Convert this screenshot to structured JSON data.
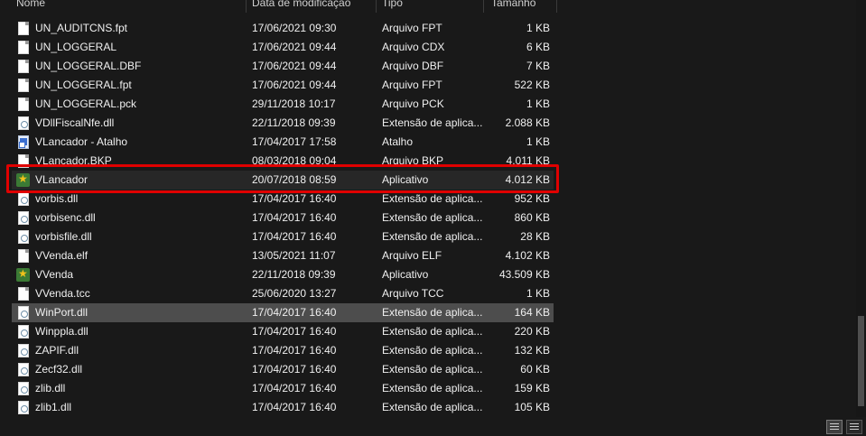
{
  "columns": {
    "name": "Nome",
    "date": "Data de modificação",
    "type": "Tipo",
    "size": "Tamanho"
  },
  "files": [
    {
      "name": "UN_AUDITCNS.fpt",
      "date": "17/06/2021 09:30",
      "type": "Arquivo FPT",
      "size": "1 KB",
      "icon": "file-icon"
    },
    {
      "name": "UN_LOGGERAL",
      "date": "17/06/2021 09:44",
      "type": "Arquivo CDX",
      "size": "6 KB",
      "icon": "file-icon"
    },
    {
      "name": "UN_LOGGERAL.DBF",
      "date": "17/06/2021 09:44",
      "type": "Arquivo DBF",
      "size": "7 KB",
      "icon": "file-icon"
    },
    {
      "name": "UN_LOGGERAL.fpt",
      "date": "17/06/2021 09:44",
      "type": "Arquivo FPT",
      "size": "522 KB",
      "icon": "file-icon"
    },
    {
      "name": "UN_LOGGERAL.pck",
      "date": "29/11/2018 10:17",
      "type": "Arquivo PCK",
      "size": "1 KB",
      "icon": "file-icon"
    },
    {
      "name": "VDllFiscalNfe.dll",
      "date": "22/11/2018 09:39",
      "type": "Extensão de aplica...",
      "size": "2.088 KB",
      "icon": "dll-icon"
    },
    {
      "name": "VLancador - Atalho",
      "date": "17/04/2017 17:58",
      "type": "Atalho",
      "size": "1 KB",
      "icon": "shortcut-icon"
    },
    {
      "name": "VLancador.BKP",
      "date": "08/03/2018 09:04",
      "type": "Arquivo BKP",
      "size": "4.011 KB",
      "icon": "file-icon"
    },
    {
      "name": "VLancador",
      "date": "20/07/2018 08:59",
      "type": "Aplicativo",
      "size": "4.012 KB",
      "icon": "app-icon"
    },
    {
      "name": "vorbis.dll",
      "date": "17/04/2017 16:40",
      "type": "Extensão de aplica...",
      "size": "952 KB",
      "icon": "dll-icon"
    },
    {
      "name": "vorbisenc.dll",
      "date": "17/04/2017 16:40",
      "type": "Extensão de aplica...",
      "size": "860 KB",
      "icon": "dll-icon"
    },
    {
      "name": "vorbisfile.dll",
      "date": "17/04/2017 16:40",
      "type": "Extensão de aplica...",
      "size": "28 KB",
      "icon": "dll-icon"
    },
    {
      "name": "VVenda.elf",
      "date": "13/05/2021 11:07",
      "type": "Arquivo ELF",
      "size": "4.102 KB",
      "icon": "file-icon"
    },
    {
      "name": "VVenda",
      "date": "22/11/2018 09:39",
      "type": "Aplicativo",
      "size": "43.509 KB",
      "icon": "app-icon"
    },
    {
      "name": "VVenda.tcc",
      "date": "25/06/2020 13:27",
      "type": "Arquivo TCC",
      "size": "1 KB",
      "icon": "file-icon"
    },
    {
      "name": "WinPort.dll",
      "date": "17/04/2017 16:40",
      "type": "Extensão de aplica...",
      "size": "164 KB",
      "icon": "dll-icon"
    },
    {
      "name": "Winppla.dll",
      "date": "17/04/2017 16:40",
      "type": "Extensão de aplica...",
      "size": "220 KB",
      "icon": "dll-icon"
    },
    {
      "name": "ZAPIF.dll",
      "date": "17/04/2017 16:40",
      "type": "Extensão de aplica...",
      "size": "132 KB",
      "icon": "dll-icon"
    },
    {
      "name": "Zecf32.dll",
      "date": "17/04/2017 16:40",
      "type": "Extensão de aplica...",
      "size": "60 KB",
      "icon": "dll-icon"
    },
    {
      "name": "zlib.dll",
      "date": "17/04/2017 16:40",
      "type": "Extensão de aplica...",
      "size": "159 KB",
      "icon": "dll-icon"
    },
    {
      "name": "zlib1.dll",
      "date": "17/04/2017 16:40",
      "type": "Extensão de aplica...",
      "size": "105 KB",
      "icon": "dll-icon"
    }
  ],
  "selected_file": "WinPort.dll",
  "highlighted_file": "VLancador",
  "colors": {
    "background": "#191919",
    "selection": "#4d4d4d",
    "highlight_border": "#e00000"
  },
  "statusbar": {
    "details_view_icon": "details-view-icon",
    "large_icons_view_icon": "large-icons-view-icon"
  }
}
